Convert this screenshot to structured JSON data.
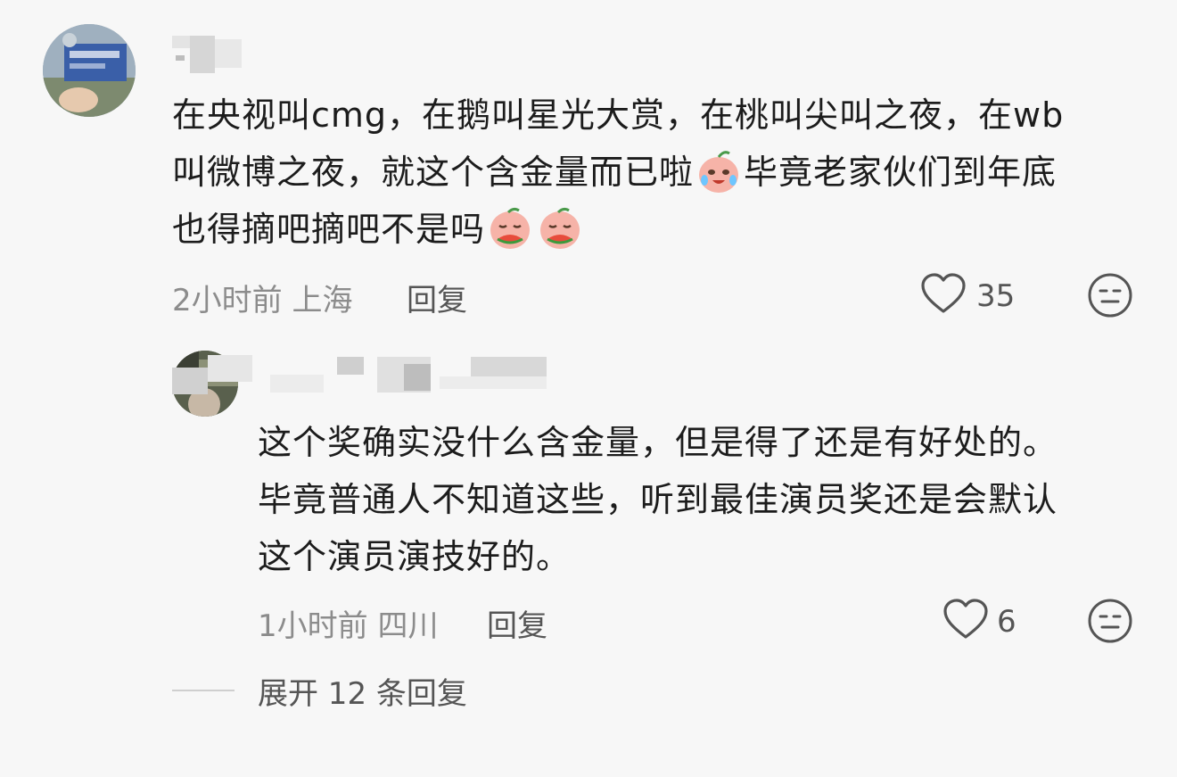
{
  "comment": {
    "lines": [
      "在央视叫cmg，在鹅叫星光大赏，在桃叫尖叫之夜，在wb",
      "叫微博之夜，就这个含金量而已啦",
      "毕竟老家伙们到年底",
      "也得摘吧摘吧不是吗"
    ],
    "emoji_1": "crying-laughing-peach-emoji",
    "emoji_2": "peach-eating-watermelon-emoji",
    "time": "2小时前",
    "location": "上海",
    "reply_label": "回复",
    "likes": "35"
  },
  "reply": {
    "lines": [
      "这个奖确实没什么含金量，但是得了还是有好处的。",
      "毕竟普通人不知道这些，听到最佳演员奖还是会默认",
      "这个演员演技好的。"
    ],
    "time": "1小时前",
    "location": "四川",
    "reply_label": "回复",
    "likes": "6"
  },
  "expand_label": "展开 12 条回复"
}
